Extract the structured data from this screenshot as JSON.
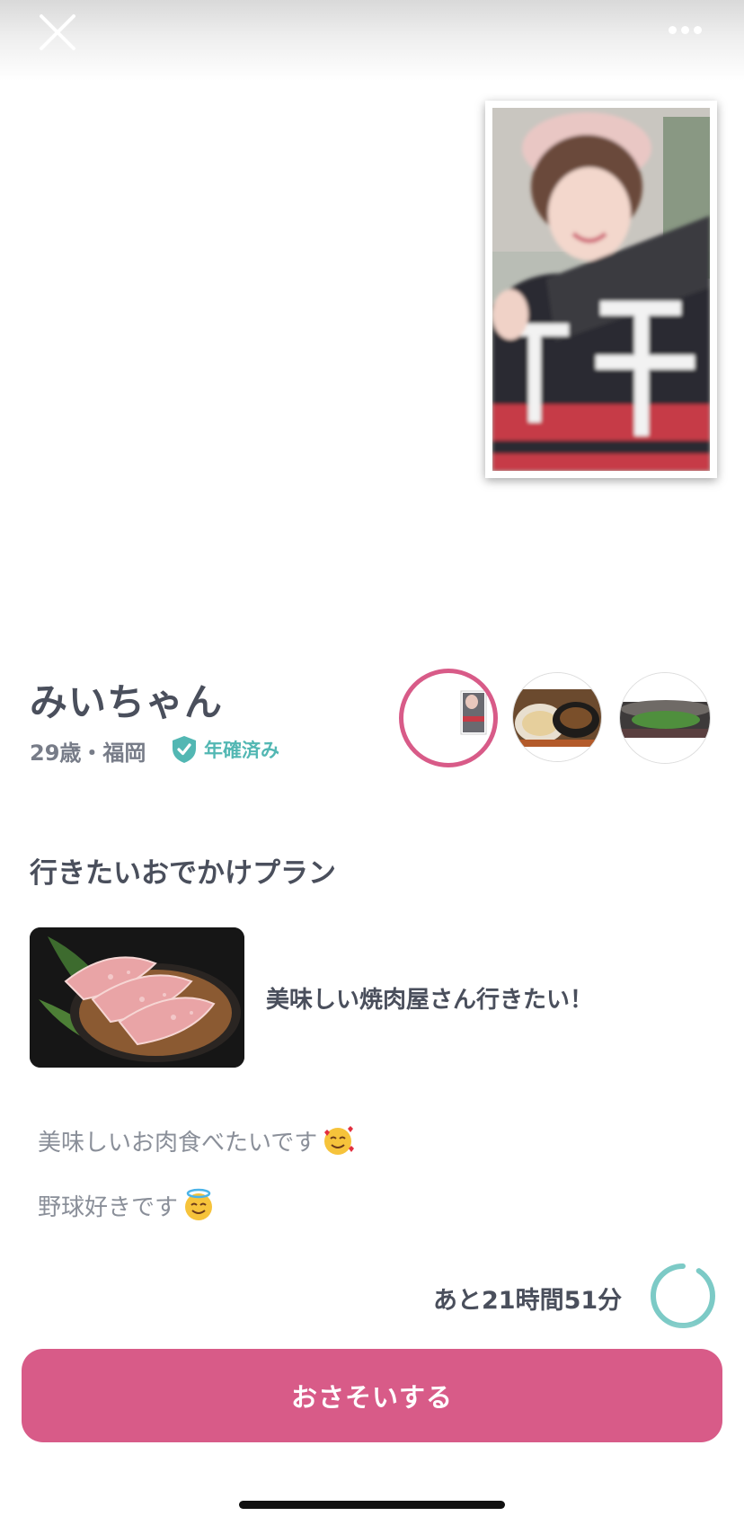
{
  "header": {
    "close_icon": "close-icon",
    "more_icon": "more-horizontal-icon"
  },
  "profile": {
    "name": "みいちゃん",
    "age_location": "29歳・福岡",
    "verified_label": "年確済み",
    "verified_icon": "shield-check-icon"
  },
  "thumbnails": [
    {
      "label": "profile-photo",
      "selected": true
    },
    {
      "label": "food-photo",
      "selected": false
    },
    {
      "label": "stadium-photo",
      "selected": false
    }
  ],
  "plan": {
    "section_title": "行きたいおでかけプラン",
    "title": "美味しい焼肉屋さん行きたい！"
  },
  "description": {
    "line1": "美味しいお肉食べたいです",
    "line2": "野球好きです"
  },
  "timer": {
    "label": "あと21時間51分",
    "fraction_remaining": 0.91
  },
  "actions": {
    "invite_label": "おさそいする"
  },
  "colors": {
    "accent": "#d85b88",
    "verified": "#52b7b3",
    "text": "#4a4f5c",
    "subtext": "#8a8f99"
  }
}
